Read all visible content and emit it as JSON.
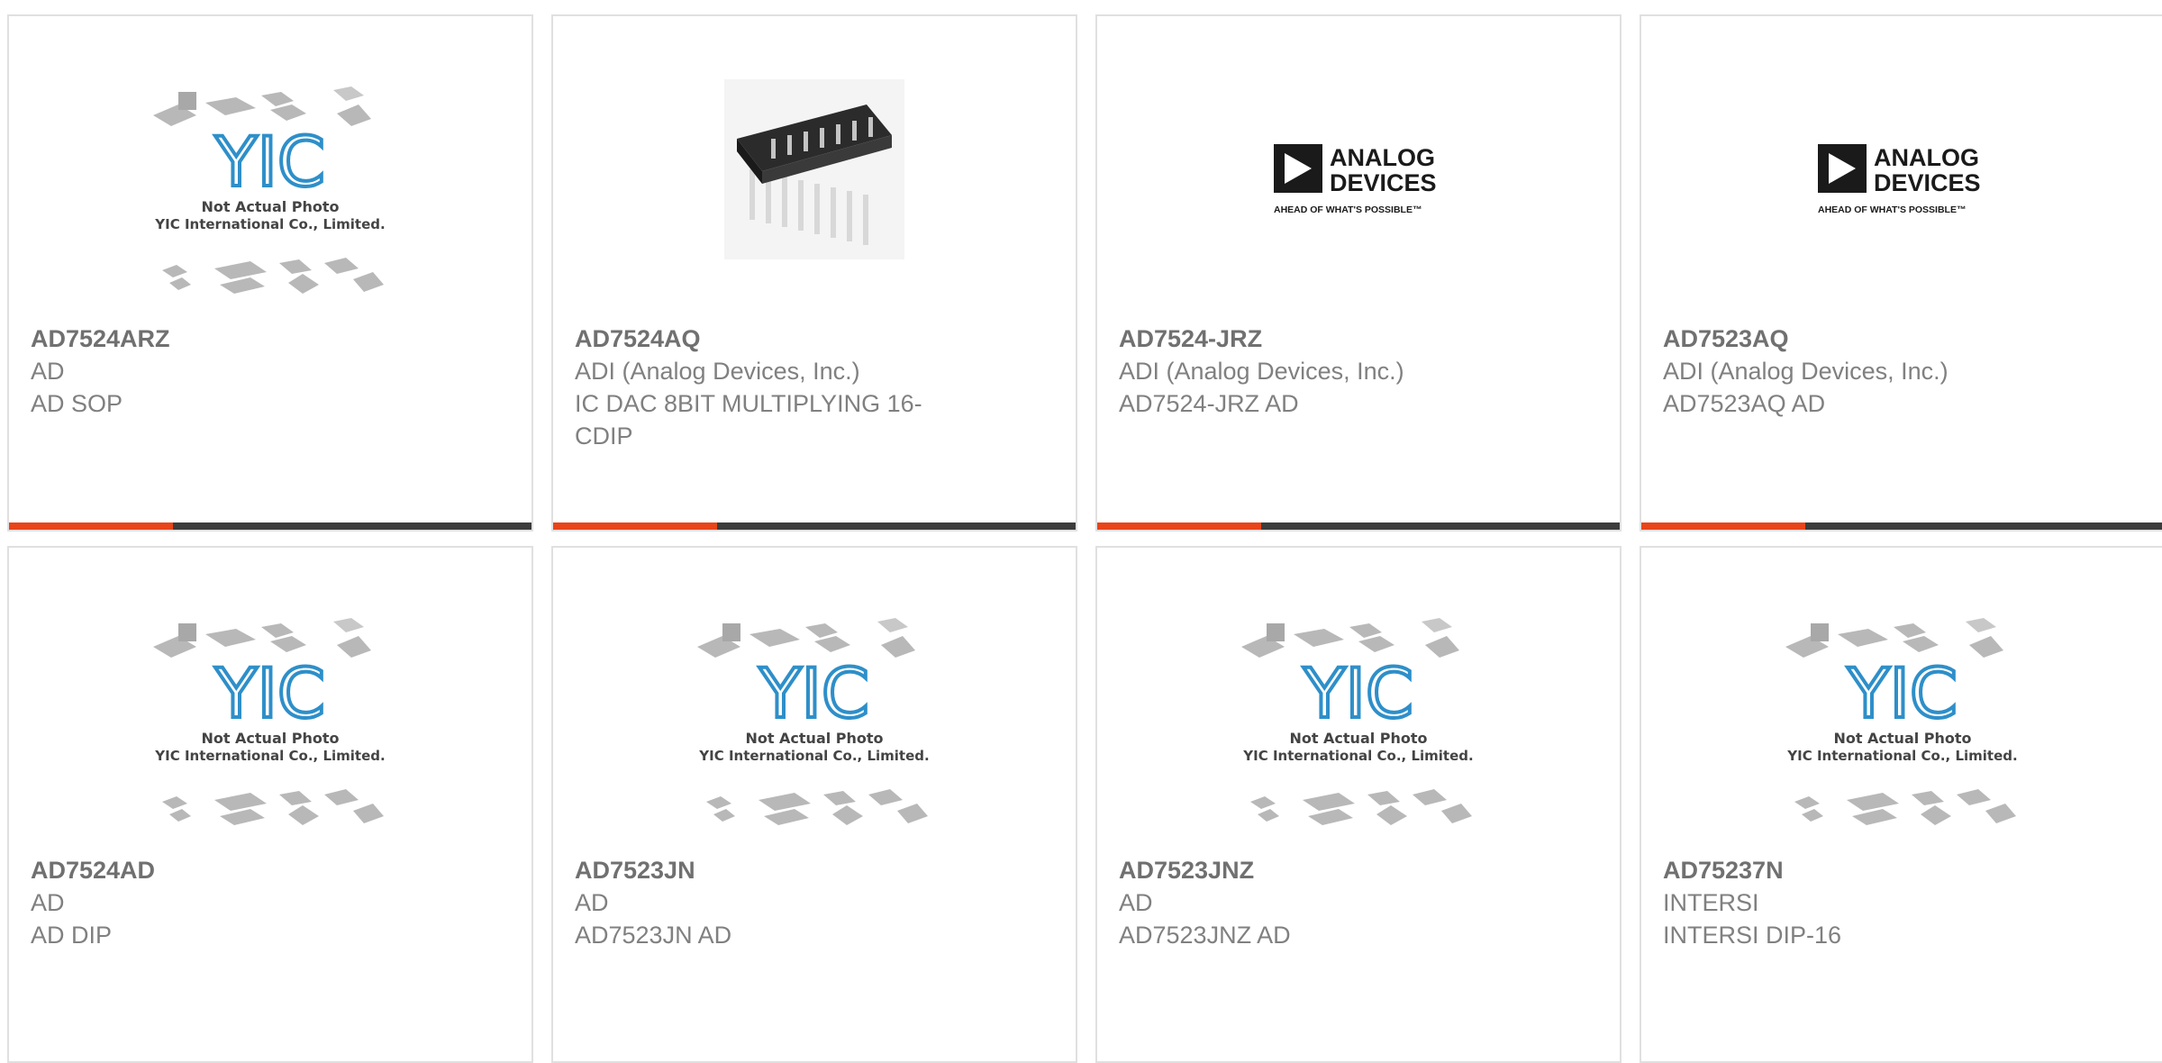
{
  "products": [
    {
      "part": "AD7524ARZ",
      "manufacturer": "AD",
      "description": "AD SOP",
      "image": "yic-placeholder",
      "accent": "#e8441a"
    },
    {
      "part": "AD7524AQ",
      "manufacturer": "ADI (Analog Devices, Inc.)",
      "description": "IC DAC 8BIT MULTIPLYING 16-CDIP",
      "image": "dip-chip-photo",
      "accent": "#e8441a"
    },
    {
      "part": "AD7524-JRZ",
      "manufacturer": "ADI (Analog Devices, Inc.)",
      "description": "AD7524-JRZ AD",
      "image": "analog-devices-logo",
      "accent": "#e8441a"
    },
    {
      "part": "AD7523AQ",
      "manufacturer": "ADI (Analog Devices, Inc.)",
      "description": "AD7523AQ AD",
      "image": "analog-devices-logo",
      "accent": "#e8441a"
    },
    {
      "part": "AD7524AD",
      "manufacturer": "AD",
      "description": "AD DIP",
      "image": "yic-placeholder"
    },
    {
      "part": "AD7523JN",
      "manufacturer": "AD",
      "description": "AD7523JN AD",
      "image": "yic-placeholder"
    },
    {
      "part": "AD7523JNZ",
      "manufacturer": "AD",
      "description": "AD7523JNZ AD",
      "image": "yic-placeholder"
    },
    {
      "part": "AD75237N",
      "manufacturer": "INTERSI",
      "description": "INTERSI DIP-16",
      "image": "yic-placeholder"
    }
  ],
  "placeholder": {
    "line1": "Not Actual Photo",
    "line2": "YIC International Co., Limited.",
    "brand": "YIC"
  },
  "adi_logo": {
    "line1": "ANALOG",
    "line2": "DEVICES",
    "tagline": "AHEAD OF WHAT'S POSSIBLE™"
  }
}
